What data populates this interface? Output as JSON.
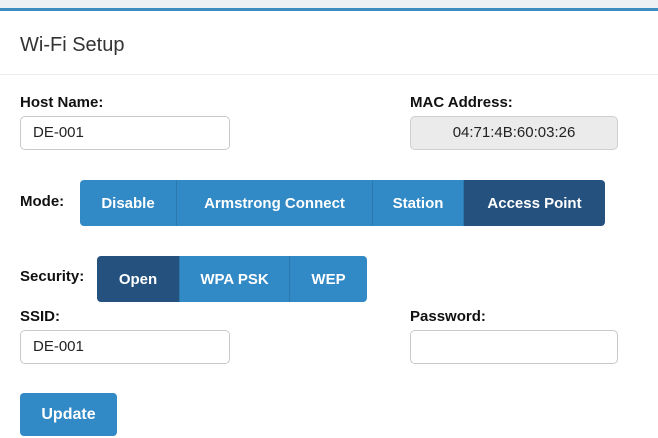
{
  "panel": {
    "title": "Wi-Fi Setup"
  },
  "host": {
    "label": "Host Name:",
    "value": "DE-001"
  },
  "mac": {
    "label": "MAC Address:",
    "value": "04:71:4B:60:03:26"
  },
  "mode": {
    "label": "Mode:",
    "options": [
      "Disable",
      "Armstrong Connect",
      "Station",
      "Access Point"
    ],
    "selected": "Access Point"
  },
  "security": {
    "label": "Security:",
    "options": [
      "Open",
      "WPA PSK",
      "WEP"
    ],
    "selected": "Open"
  },
  "ssid": {
    "label": "SSID:",
    "value": "DE-001"
  },
  "password": {
    "label": "Password:",
    "value": ""
  },
  "actions": {
    "update_label": "Update"
  },
  "colors": {
    "accent": "#3189c5",
    "accent_active": "#24517e",
    "top_rule": "#3d8cbf"
  }
}
